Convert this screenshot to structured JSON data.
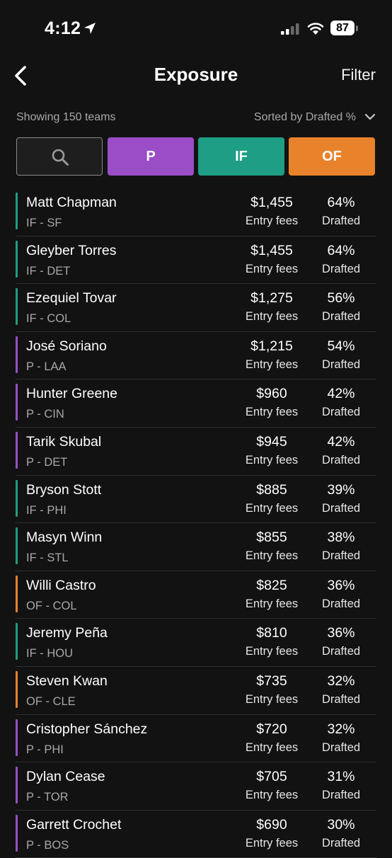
{
  "status_bar": {
    "time": "4:12",
    "battery": "87"
  },
  "nav": {
    "title": "Exposure",
    "filter_label": "Filter"
  },
  "meta": {
    "showing": "Showing 150 teams",
    "sorted": "Sorted by Drafted %"
  },
  "filters": {
    "p": "P",
    "if": "IF",
    "of": "OF"
  },
  "colors": {
    "P": "#9a4dc7",
    "IF": "#1e9e84",
    "OF": "#e8832b"
  },
  "players": [
    {
      "name": "Matt Chapman",
      "pos": "IF - SF",
      "group": "IF",
      "fee": "$1,455",
      "fee_label": "Entry fees",
      "pct": "64%",
      "pct_label": "Drafted"
    },
    {
      "name": "Gleyber Torres",
      "pos": "IF - DET",
      "group": "IF",
      "fee": "$1,455",
      "fee_label": "Entry fees",
      "pct": "64%",
      "pct_label": "Drafted"
    },
    {
      "name": "Ezequiel Tovar",
      "pos": "IF - COL",
      "group": "IF",
      "fee": "$1,275",
      "fee_label": "Entry fees",
      "pct": "56%",
      "pct_label": "Drafted"
    },
    {
      "name": "José Soriano",
      "pos": "P - LAA",
      "group": "P",
      "fee": "$1,215",
      "fee_label": "Entry fees",
      "pct": "54%",
      "pct_label": "Drafted"
    },
    {
      "name": "Hunter Greene",
      "pos": "P - CIN",
      "group": "P",
      "fee": "$960",
      "fee_label": "Entry fees",
      "pct": "42%",
      "pct_label": "Drafted"
    },
    {
      "name": "Tarik Skubal",
      "pos": "P - DET",
      "group": "P",
      "fee": "$945",
      "fee_label": "Entry fees",
      "pct": "42%",
      "pct_label": "Drafted"
    },
    {
      "name": "Bryson Stott",
      "pos": "IF - PHI",
      "group": "IF",
      "fee": "$885",
      "fee_label": "Entry fees",
      "pct": "39%",
      "pct_label": "Drafted"
    },
    {
      "name": "Masyn Winn",
      "pos": "IF - STL",
      "group": "IF",
      "fee": "$855",
      "fee_label": "Entry fees",
      "pct": "38%",
      "pct_label": "Drafted"
    },
    {
      "name": "Willi Castro",
      "pos": "OF - COL",
      "group": "OF",
      "fee": "$825",
      "fee_label": "Entry fees",
      "pct": "36%",
      "pct_label": "Drafted"
    },
    {
      "name": "Jeremy Peña",
      "pos": "IF - HOU",
      "group": "IF",
      "fee": "$810",
      "fee_label": "Entry fees",
      "pct": "36%",
      "pct_label": "Drafted"
    },
    {
      "name": "Steven Kwan",
      "pos": "OF - CLE",
      "group": "OF",
      "fee": "$735",
      "fee_label": "Entry fees",
      "pct": "32%",
      "pct_label": "Drafted"
    },
    {
      "name": "Cristopher Sánchez",
      "pos": "P - PHI",
      "group": "P",
      "fee": "$720",
      "fee_label": "Entry fees",
      "pct": "32%",
      "pct_label": "Drafted"
    },
    {
      "name": "Dylan Cease",
      "pos": "P - TOR",
      "group": "P",
      "fee": "$705",
      "fee_label": "Entry fees",
      "pct": "31%",
      "pct_label": "Drafted"
    },
    {
      "name": "Garrett Crochet",
      "pos": "P - BOS",
      "group": "P",
      "fee": "$690",
      "fee_label": "Entry fees",
      "pct": "30%",
      "pct_label": "Drafted"
    }
  ]
}
